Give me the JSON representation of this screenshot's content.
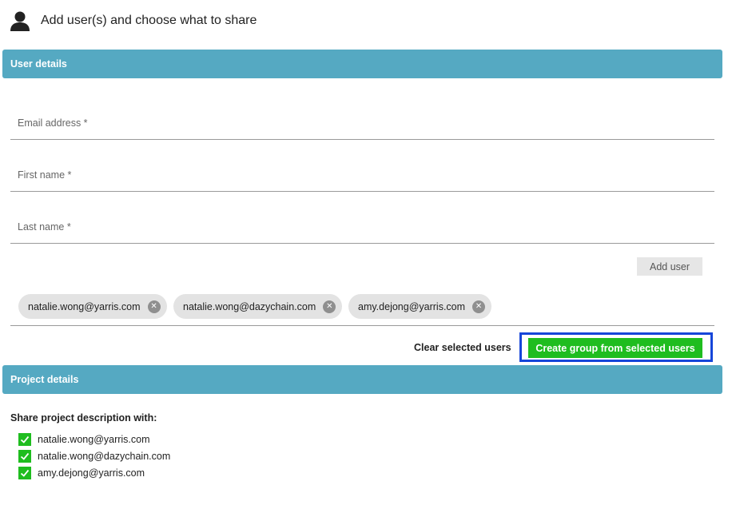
{
  "header": {
    "title": "Add user(s) and choose what to share",
    "icon": "user-icon"
  },
  "user_details": {
    "section_title": "User details",
    "fields": {
      "email": {
        "label": "Email address *",
        "value": ""
      },
      "first_name": {
        "label": "First name *",
        "value": ""
      },
      "last_name": {
        "label": "Last name *",
        "value": ""
      }
    },
    "add_user_label": "Add user",
    "selected_users": [
      {
        "email": "natalie.wong@yarris.com"
      },
      {
        "email": "natalie.wong@dazychain.com"
      },
      {
        "email": "amy.dejong@yarris.com"
      }
    ],
    "clear_label": "Clear selected users",
    "create_group_label": "Create group from selected users"
  },
  "project_details": {
    "section_title": "Project details",
    "share_label": "Share project description with:",
    "share_with": [
      {
        "email": "natalie.wong@yarris.com",
        "checked": true
      },
      {
        "email": "natalie.wong@dazychain.com",
        "checked": true
      },
      {
        "email": "amy.dejong@yarris.com",
        "checked": true
      }
    ]
  },
  "colors": {
    "section_bar": "#55a9c2",
    "primary_button": "#1fbd1f",
    "focus_outline": "#1646d9"
  }
}
